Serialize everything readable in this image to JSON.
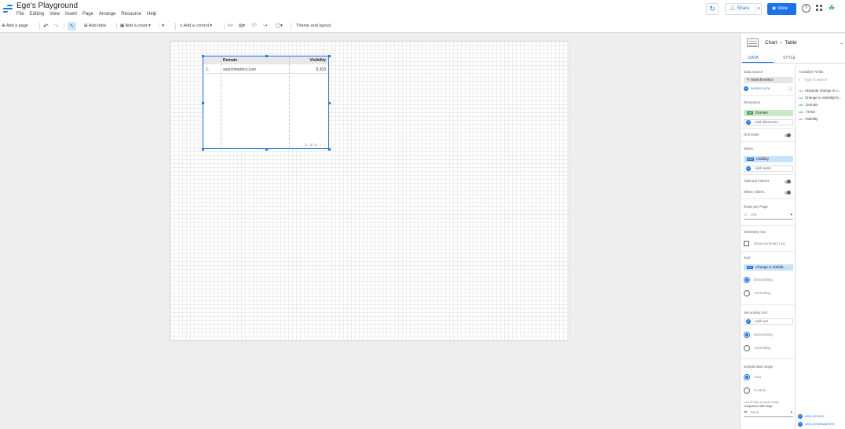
{
  "app": {
    "title": "Ege's Playground",
    "menus": [
      "File",
      "Editing",
      "View",
      "Insert",
      "Page",
      "Arrange",
      "Resource",
      "Help"
    ],
    "share_label": "Share",
    "view_label": "View",
    "brand_color": "#1a73e8"
  },
  "toolbar": {
    "add_page": "Add a page",
    "add_data": "Add data",
    "add_chart": "Add a chart",
    "add_control": "Add a control",
    "theme": "Theme and layout"
  },
  "table": {
    "columns": [
      "Domain",
      "Visibility"
    ],
    "rows": [
      {
        "n": "1.",
        "domain": "searchmetrics.com",
        "visibility": "8,303"
      }
    ],
    "pager": "1 - 1 / 1"
  },
  "panel": {
    "title_chart": "Chart",
    "title_type": "Table",
    "tabs": {
      "data": "DATA",
      "style": "STYLE"
    },
    "data_source_label": "Data source",
    "data_source": "Searchmetrics",
    "blend": "BLEND DATA",
    "dimension_label": "Dimension",
    "dimension": "Domain",
    "add_dimension": "Add dimension",
    "drill_down": "Drill down",
    "metric_label": "Metric",
    "metric": "Visibility",
    "add_metric": "Add metric",
    "optional_metrics": "Optional metrics",
    "metric_sliders": "Metric sliders",
    "rows_per_page_label": "Rows per Page",
    "rows_per_page": "100",
    "summary_row_label": "Summary row",
    "show_summary_row": "Show summary row",
    "sort_label": "Sort",
    "sort_field": "Change in visibilit...",
    "descending": "Descending",
    "ascending": "Ascending",
    "secondary_sort_label": "Secondary sort",
    "add_sort": "Add sort",
    "date_range_label": "Default date range",
    "auto": "Auto",
    "custom": "Custom",
    "date_note": "Last 28 days (exclude today)",
    "comparison_label": "Comparison date range",
    "comparison": "None",
    "available_fields_label": "Available Fields",
    "search_placeholder": "Type to search",
    "fields": [
      "Absolute change in v...",
      "Change in visibility(%...",
      "Domain",
      "Trend",
      "Visibility"
    ],
    "add_field": "ADD A FIELD",
    "add_parameter": "ADD A PARAMETER"
  }
}
